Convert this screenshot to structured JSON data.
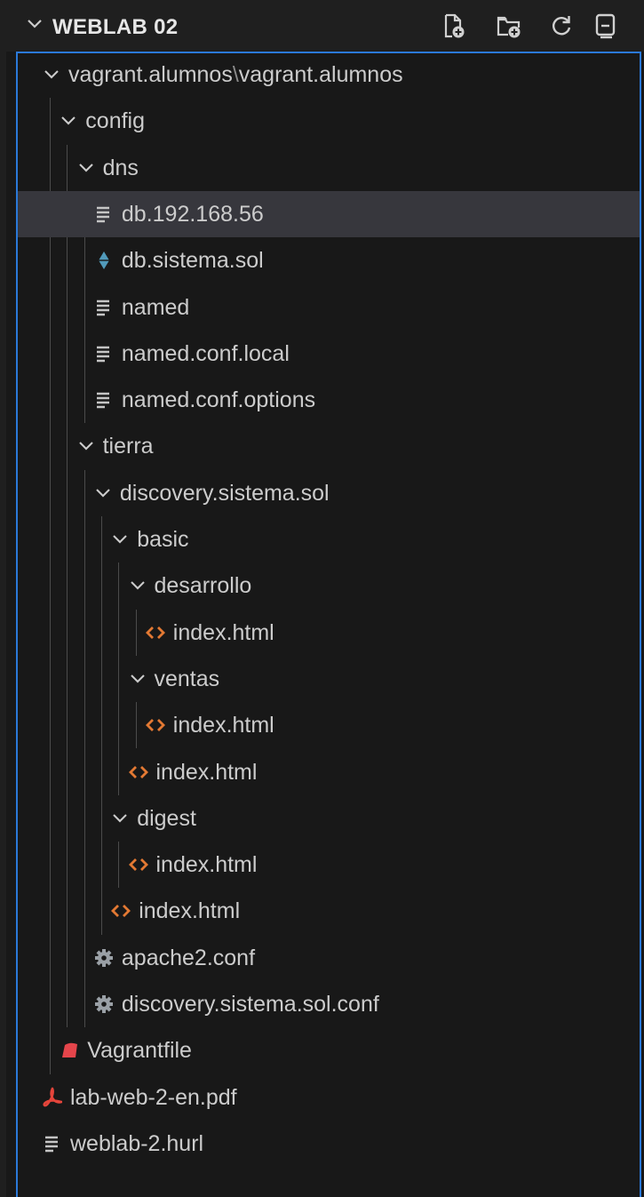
{
  "header": {
    "title": "WEBLAB 02",
    "actions": [
      "new-file-icon",
      "new-folder-icon",
      "refresh-icon",
      "collapse-all-icon"
    ]
  },
  "tree": [
    {
      "label": "vagrant.alumnos",
      "label_suffix": "vagrant.alumnos",
      "separator": "\\",
      "type": "folder",
      "depth": 0,
      "expanded": true,
      "icon": "chevron-down-icon"
    },
    {
      "label": "config",
      "type": "folder",
      "depth": 1,
      "expanded": true,
      "icon": "chevron-down-icon"
    },
    {
      "label": "dns",
      "type": "folder",
      "depth": 2,
      "expanded": true,
      "icon": "chevron-down-icon"
    },
    {
      "label": "db.192.168.56",
      "type": "file",
      "depth": 3,
      "icon": "text-file-icon",
      "selected": true
    },
    {
      "label": "db.sistema.sol",
      "type": "file",
      "depth": 3,
      "icon": "diamond-file-icon"
    },
    {
      "label": "named",
      "type": "file",
      "depth": 3,
      "icon": "text-file-icon"
    },
    {
      "label": "named.conf.local",
      "type": "file",
      "depth": 3,
      "icon": "text-file-icon"
    },
    {
      "label": "named.conf.options",
      "type": "file",
      "depth": 3,
      "icon": "text-file-icon"
    },
    {
      "label": "tierra",
      "type": "folder",
      "depth": 2,
      "expanded": true,
      "icon": "chevron-down-icon"
    },
    {
      "label": "discovery.sistema.sol",
      "type": "folder",
      "depth": 3,
      "expanded": true,
      "icon": "chevron-down-icon"
    },
    {
      "label": "basic",
      "type": "folder",
      "depth": 4,
      "expanded": true,
      "icon": "chevron-down-icon"
    },
    {
      "label": "desarrollo",
      "type": "folder",
      "depth": 5,
      "expanded": true,
      "icon": "chevron-down-icon"
    },
    {
      "label": "index.html",
      "type": "file",
      "depth": 6,
      "icon": "html-file-icon"
    },
    {
      "label": "ventas",
      "type": "folder",
      "depth": 5,
      "expanded": true,
      "icon": "chevron-down-icon"
    },
    {
      "label": "index.html",
      "type": "file",
      "depth": 6,
      "icon": "html-file-icon"
    },
    {
      "label": "index.html",
      "type": "file",
      "depth": 5,
      "icon": "html-file-icon"
    },
    {
      "label": "digest",
      "type": "folder",
      "depth": 4,
      "expanded": true,
      "icon": "chevron-down-icon"
    },
    {
      "label": "index.html",
      "type": "file",
      "depth": 5,
      "icon": "html-file-icon"
    },
    {
      "label": "index.html",
      "type": "file",
      "depth": 4,
      "icon": "html-file-icon"
    },
    {
      "label": "apache2.conf",
      "type": "file",
      "depth": 3,
      "icon": "gear-file-icon"
    },
    {
      "label": "discovery.sistema.sol.conf",
      "type": "file",
      "depth": 3,
      "icon": "gear-file-icon"
    },
    {
      "label": "Vagrantfile",
      "type": "file",
      "depth": 1,
      "icon": "vagrant-file-icon"
    },
    {
      "label": "lab-web-2-en.pdf",
      "type": "file",
      "depth": 0,
      "icon": "pdf-file-icon"
    },
    {
      "label": "weblab-2.hurl",
      "type": "file",
      "depth": 0,
      "icon": "text-file-icon"
    }
  ],
  "colors": {
    "background": "#181818",
    "header_background": "#1f1f1f",
    "selection": "#37373d",
    "focus_border": "#2b79d8",
    "text": "#cccccc",
    "html_icon": "#e37933",
    "pdf_icon": "#e5453b",
    "vagrant_icon": "#e5454b",
    "diamond_icon": "#519aba",
    "gear_icon": "#9aa0a6"
  }
}
